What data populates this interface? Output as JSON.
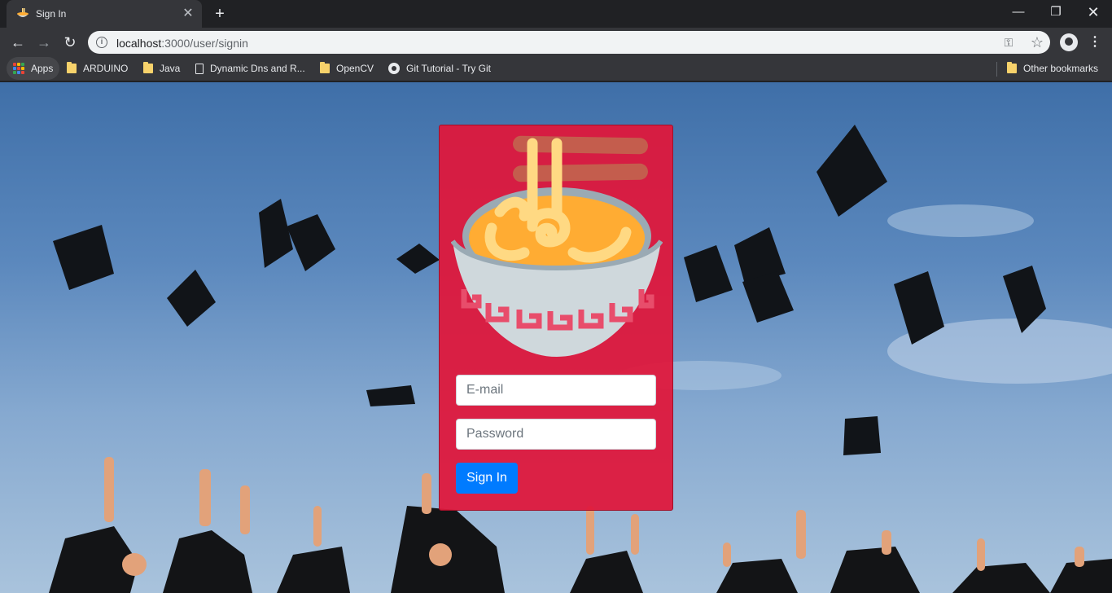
{
  "browser": {
    "tab_title": "Sign In",
    "tab_icon": "ramen-bowl-icon",
    "url_host": "localhost",
    "url_rest": ":3000/user/signin"
  },
  "bookmarks": {
    "apps_label": "Apps",
    "items": [
      "ARDUINO",
      "Java",
      "Dynamic Dns and R...",
      "OpenCV",
      "Git Tutorial - Try Git"
    ],
    "other_label": "Other bookmarks"
  },
  "form": {
    "email_placeholder": "E-mail",
    "password_placeholder": "Password",
    "submit_label": "Sign In"
  },
  "colors": {
    "card": "#df173b",
    "button": "#007bff",
    "bowl": "#cfd8dc",
    "broth": "#ffac33",
    "noodles": "#ffd983",
    "chopsticks": "#c1694f"
  }
}
